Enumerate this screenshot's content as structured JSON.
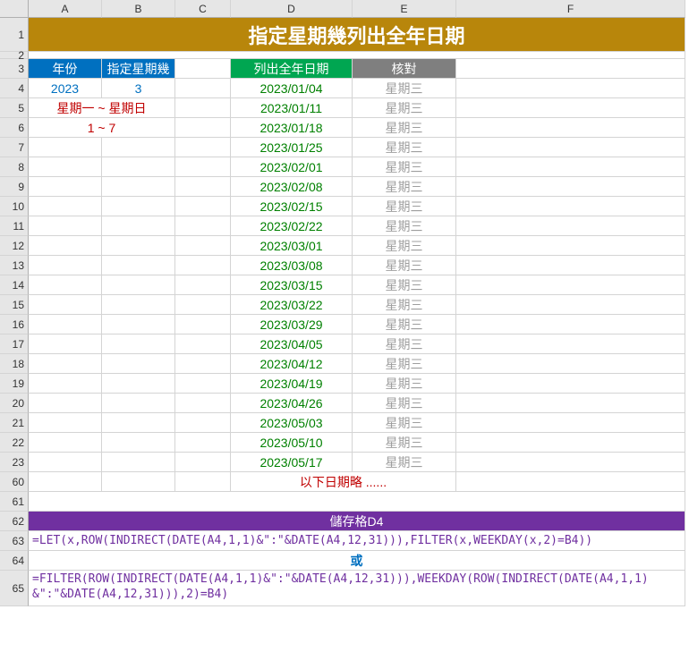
{
  "columns": [
    "A",
    "B",
    "C",
    "D",
    "E",
    "F"
  ],
  "visible_rows": [
    1,
    2,
    3,
    4,
    5,
    6,
    7,
    8,
    9,
    10,
    11,
    12,
    13,
    14,
    15,
    16,
    17,
    18,
    19,
    20,
    21,
    22,
    23,
    60,
    61,
    62,
    63,
    64,
    65
  ],
  "title": "指定星期幾列出全年日期",
  "headers": {
    "year": "年份",
    "weekday": "指定星期幾",
    "dates": "列出全年日期",
    "check": "核對"
  },
  "year_value": "2023",
  "weekday_value": "3",
  "hints": {
    "range_label": "星期一 ~ 星期日",
    "range_nums": "1 ~ 7"
  },
  "date_list": [
    "2023/01/04",
    "2023/01/11",
    "2023/01/18",
    "2023/01/25",
    "2023/02/01",
    "2023/02/08",
    "2023/02/15",
    "2023/02/22",
    "2023/03/01",
    "2023/03/08",
    "2023/03/15",
    "2023/03/22",
    "2023/03/29",
    "2023/04/05",
    "2023/04/12",
    "2023/04/19",
    "2023/04/26",
    "2023/05/03",
    "2023/05/10",
    "2023/05/17"
  ],
  "check_value": "星期三",
  "omit_text": "以下日期略 ......",
  "formula_header": "儲存格D4",
  "formula1": "=LET(x,ROW(INDIRECT(DATE(A4,1,1)&\":\"&DATE(A4,12,31))),FILTER(x,WEEKDAY(x,2)=B4))",
  "or_text": "或",
  "formula2": "=FILTER(ROW(INDIRECT(DATE(A4,1,1)&\":\"&DATE(A4,12,31))),WEEKDAY(ROW(INDIRECT(DATE(A4,1,1)&\":\"&DATE(A4,12,31))),2)=B4)"
}
